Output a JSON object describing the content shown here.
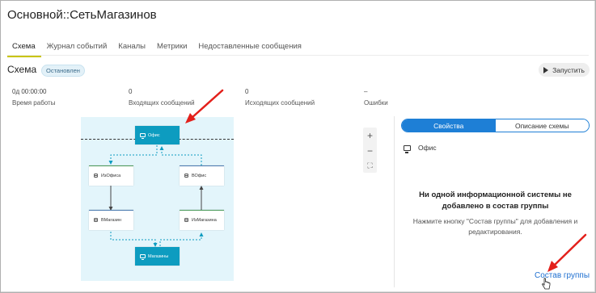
{
  "header": {
    "title": "Основной::СетьМагазинов"
  },
  "tabs": [
    {
      "label": "Схема",
      "active": true
    },
    {
      "label": "Журнал событий",
      "active": false
    },
    {
      "label": "Каналы",
      "active": false
    },
    {
      "label": "Метрики",
      "active": false
    },
    {
      "label": "Недоставленные сообщения",
      "active": false
    }
  ],
  "scheme": {
    "title": "Схема",
    "status": "Остановлен",
    "run_label": "Запустить"
  },
  "stats": [
    {
      "value": "0д 00:00:00",
      "label": "Время работы"
    },
    {
      "value": "0",
      "label": "Входящих сообщений"
    },
    {
      "value": "0",
      "label": "Исходящих сообщений"
    },
    {
      "value": "–",
      "label": "Ошибки"
    }
  ],
  "diagram": {
    "nodes": {
      "office": "Офис",
      "from_office": "ИзОфиса",
      "to_office": "ВОфис",
      "to_store": "ВМагазин",
      "from_store": "ИзМагазина",
      "stores": "Магазины"
    }
  },
  "zoom": {
    "plus": "+",
    "minus": "−",
    "fit": "⛶"
  },
  "right_panel": {
    "tabs": {
      "properties": "Свойства",
      "description": "Описание схемы"
    },
    "selected_item": "Офис",
    "empty_title": "Ни одной информационной системы не добавлено в состав группы",
    "empty_text": "Нажмите кнопку \"Состав группы\" для добавления и редактирования.",
    "group_link": "Состав группы"
  },
  "colors": {
    "accent": "#1e7fd6",
    "teal": "#0d9cc0",
    "diagram_bg": "#e3f5fb",
    "annotation_arrow": "#e3201b",
    "active_tab_underline": "#c9c400"
  }
}
